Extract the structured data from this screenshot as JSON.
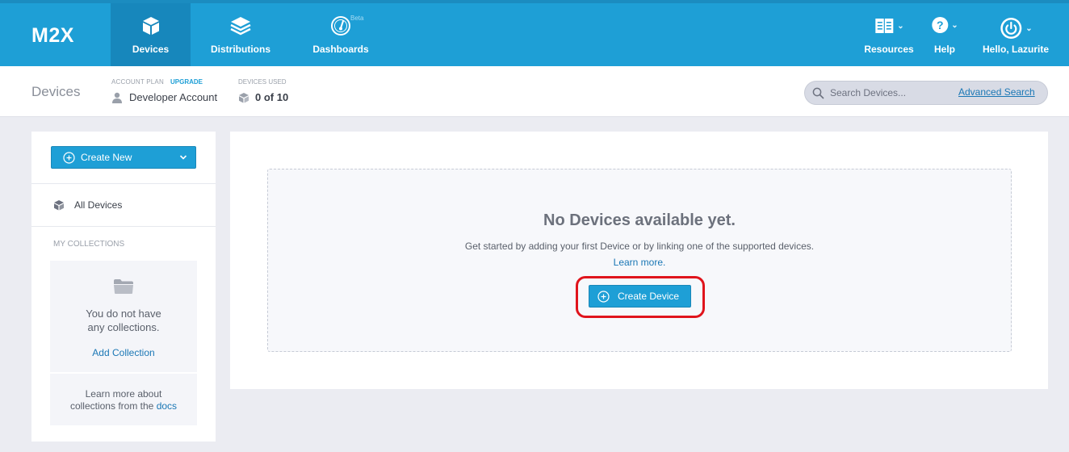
{
  "app": {
    "logo": "M2X"
  },
  "nav": {
    "devices": "Devices",
    "distributions": "Distributions",
    "dashboards": "Dashboards",
    "beta": "Beta",
    "resources": "Resources",
    "help": "Help",
    "user": "Hello, Lazurite"
  },
  "subheader": {
    "title": "Devices",
    "plan_label": "ACCOUNT PLAN",
    "upgrade": "UPGRADE",
    "plan_value": "Developer Account",
    "used_label": "DEVICES USED",
    "used_value": "0 of 10",
    "search_placeholder": "Search Devices...",
    "advanced_search": "Advanced Search"
  },
  "sidebar": {
    "create_new": "Create New",
    "all_devices": "All Devices",
    "my_collections": "MY COLLECTIONS",
    "empty_line1": "You do not have",
    "empty_line2": "any collections.",
    "add_collection": "Add Collection",
    "docs_line1": "Learn more about",
    "docs_line2": "collections from the",
    "docs_link": "docs"
  },
  "main": {
    "title": "No Devices available yet.",
    "subtitle": "Get started by adding your first Device or by linking one of the supported devices.",
    "learn_more": "Learn more.",
    "create_device": "Create Device"
  },
  "colors": {
    "brand": "#1e9fd6",
    "active_nav": "#1787bc",
    "link": "#1a77b5",
    "highlight": "#e0141c"
  }
}
